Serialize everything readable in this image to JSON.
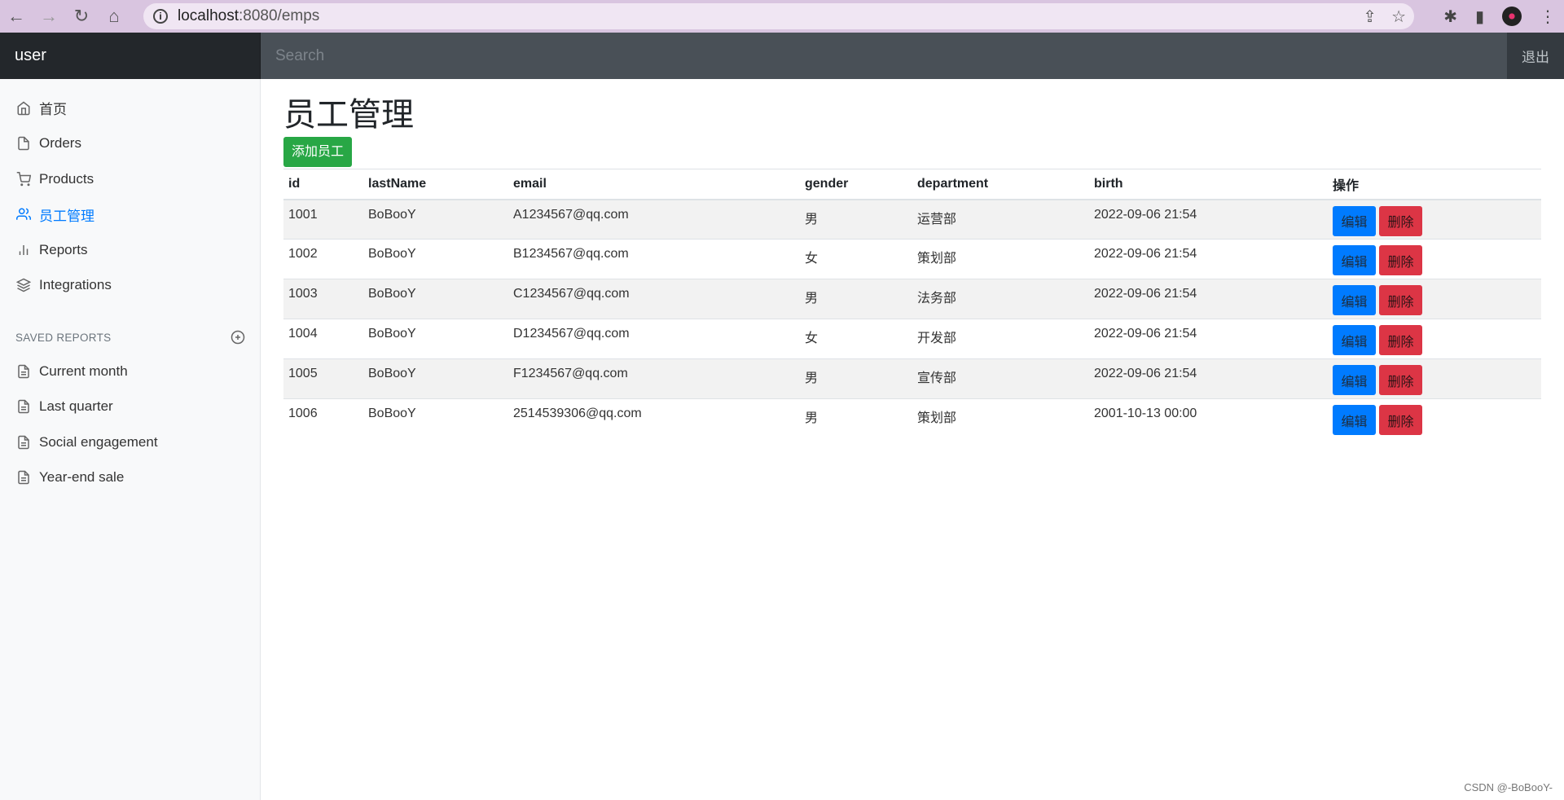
{
  "browser": {
    "url_host": "localhost",
    "url_path": ":8080/emps"
  },
  "navbar": {
    "brand": "user",
    "search_placeholder": "Search",
    "signout_label": "退出"
  },
  "sidebar": {
    "items": [
      {
        "label": "首页",
        "icon": "home-icon"
      },
      {
        "label": "Orders",
        "icon": "file-icon"
      },
      {
        "label": "Products",
        "icon": "shopping-cart-icon"
      },
      {
        "label": "员工管理",
        "icon": "users-icon",
        "active": true
      },
      {
        "label": "Reports",
        "icon": "bar-chart-icon"
      },
      {
        "label": "Integrations",
        "icon": "layers-icon"
      }
    ],
    "saved_reports_heading": "SAVED REPORTS",
    "saved_reports": [
      {
        "label": "Current month"
      },
      {
        "label": "Last quarter"
      },
      {
        "label": "Social engagement"
      },
      {
        "label": "Year-end sale"
      }
    ]
  },
  "main": {
    "title": "员工管理",
    "add_button": "添加员工",
    "table": {
      "headers": [
        "id",
        "lastName",
        "email",
        "gender",
        "department",
        "birth",
        "操作"
      ],
      "rows": [
        [
          "1001",
          "BoBooY",
          "A1234567@qq.com",
          "男",
          "运营部",
          "2022-09-06 21:54"
        ],
        [
          "1002",
          "BoBooY",
          "B1234567@qq.com",
          "女",
          "策划部",
          "2022-09-06 21:54"
        ],
        [
          "1003",
          "BoBooY",
          "C1234567@qq.com",
          "男",
          "法务部",
          "2022-09-06 21:54"
        ],
        [
          "1004",
          "BoBooY",
          "D1234567@qq.com",
          "女",
          "开发部",
          "2022-09-06 21:54"
        ],
        [
          "1005",
          "BoBooY",
          "F1234567@qq.com",
          "男",
          "宣传部",
          "2022-09-06 21:54"
        ],
        [
          "1006",
          "BoBooY",
          "2514539306@qq.com",
          "男",
          "策划部",
          "2001-10-13 00:00"
        ]
      ],
      "edit_label": "编辑",
      "delete_label": "删除"
    }
  },
  "watermark": "CSDN @-BoBooY-",
  "colors": {
    "accent": "#007bff",
    "success": "#28a745",
    "danger": "#dc3545",
    "navbar": "#343a40"
  }
}
